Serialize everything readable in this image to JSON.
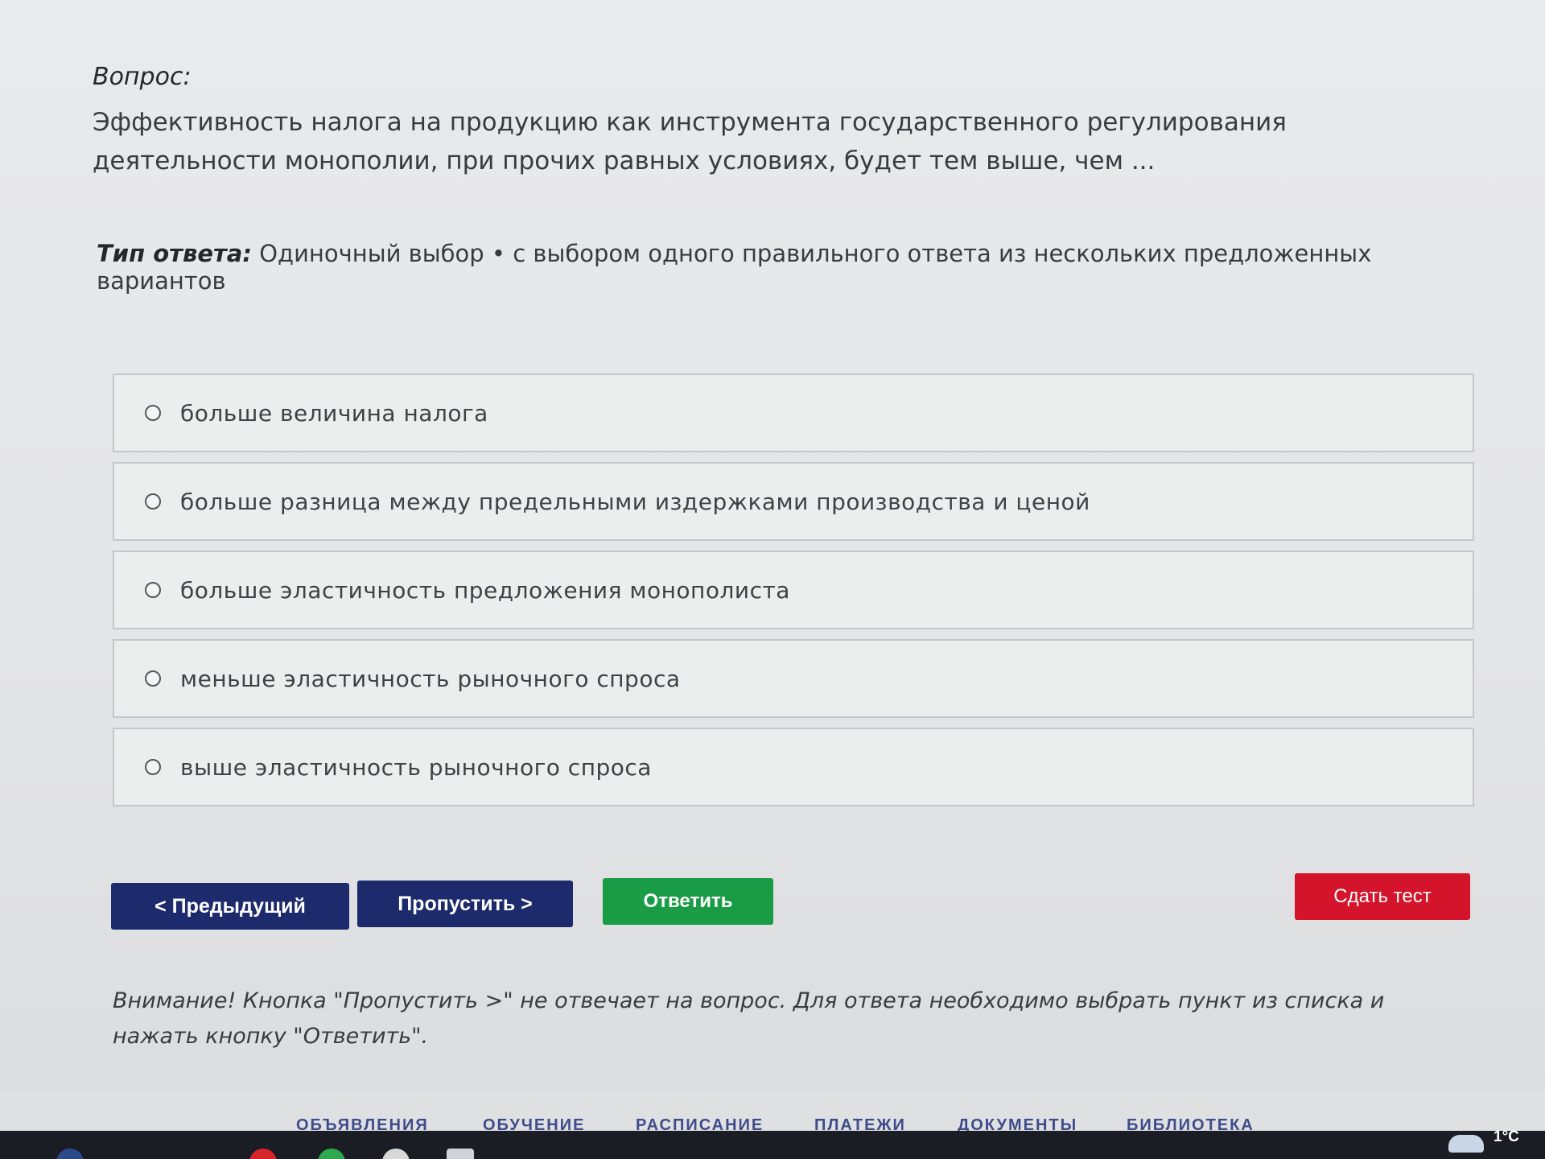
{
  "question": {
    "label": "Вопрос:",
    "text": "Эффективность налога на продукцию как инструмента государственного регулирования деятельности монополии, при прочих равных условиях, будет тем выше, чем ..."
  },
  "answer_type": {
    "label": "Тип ответа:",
    "value": "Одиночный выбор • с выбором одного правильного ответа из нескольких предложенных вариантов"
  },
  "options": [
    "больше величина налога",
    "больше разница между предельными издержками производства и ценой",
    "больше эластичность предложения монополиста",
    "меньше эластичность рыночного спроса",
    "выше эластичность рыночного спроса"
  ],
  "buttons": {
    "prev": "< Предыдущий",
    "skip": "Пропустить >",
    "answer": "Ответить",
    "submit": "Сдать тест"
  },
  "warning": "Внимание! Кнопка \"Пропустить >\" не отвечает на вопрос. Для ответа необходимо выбрать пункт из списка и нажать кнопку \"Ответить\".",
  "bottom_nav": [
    "ОБЪЯВЛЕНИЯ",
    "ОБУЧЕНИЕ",
    "РАСПИСАНИЕ",
    "ПЛАТЕЖИ",
    "ДОКУМЕНТЫ",
    "БИБЛИОТЕКА"
  ],
  "system_tray": {
    "temperature": "1°C"
  },
  "colors": {
    "primary_button": "#1d2a6b",
    "answer_button": "#1a9c47",
    "submit_button": "#d4142b"
  }
}
